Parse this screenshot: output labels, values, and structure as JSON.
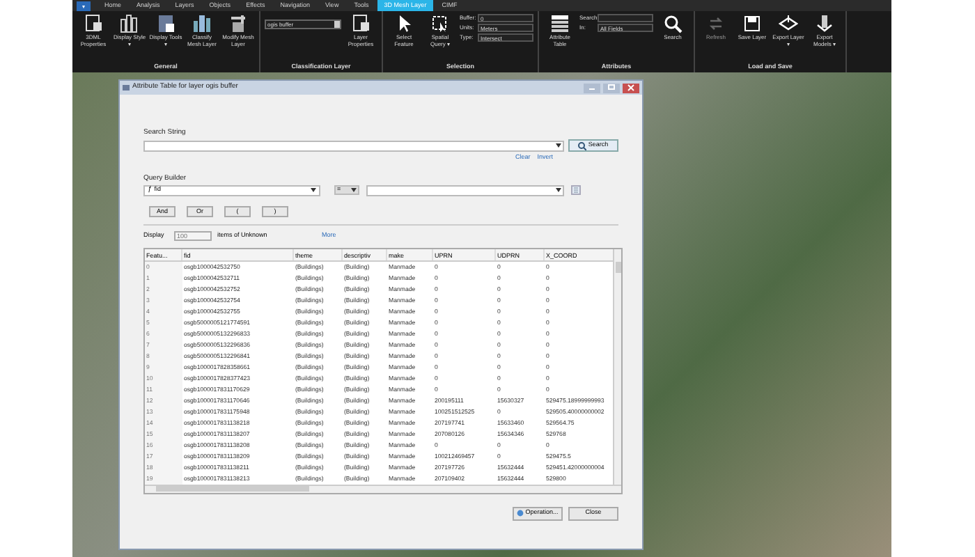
{
  "ribbon": {
    "file_button": "▾",
    "tabs": [
      {
        "label": "Home",
        "selected": false
      },
      {
        "label": "Analysis",
        "selected": false
      },
      {
        "label": "Layers",
        "selected": false
      },
      {
        "label": "Objects",
        "selected": false
      },
      {
        "label": "Effects",
        "selected": false
      },
      {
        "label": "Navigation",
        "selected": false
      },
      {
        "label": "View",
        "selected": false
      },
      {
        "label": "Tools",
        "selected": false
      },
      {
        "label": "3D Mesh Layer",
        "selected": true
      },
      {
        "label": "CIMF",
        "selected": false
      }
    ],
    "groups": [
      {
        "label": "General",
        "items": [
          {
            "kind": "button",
            "label": "3DML Properties"
          },
          {
            "kind": "button",
            "label": "Display Style ▾"
          },
          {
            "kind": "button",
            "label": "Display Tools ▾"
          },
          {
            "kind": "button",
            "label": "Classify Mesh Layer"
          },
          {
            "kind": "button",
            "label": "Modify Mesh Layer"
          }
        ]
      },
      {
        "label": "Classification Layer",
        "items": [
          {
            "kind": "combo",
            "value": "ogis buffer"
          },
          {
            "kind": "button",
            "label": "Layer Properties"
          }
        ]
      },
      {
        "label": "Selection",
        "items": [
          {
            "kind": "button",
            "label": "Select Feature"
          },
          {
            "kind": "button",
            "label": "Spatial Query ▾"
          },
          {
            "kind": "fields",
            "fields": [
              {
                "label": "Buffer:",
                "value": "0"
              },
              {
                "label": "Units:",
                "value": "Meters"
              },
              {
                "label": "Type:",
                "value": "Intersect"
              }
            ]
          }
        ]
      },
      {
        "label": "Attributes",
        "items": [
          {
            "kind": "button",
            "label": "Attribute Table"
          },
          {
            "kind": "fields",
            "fields": [
              {
                "label": "Search:"
              },
              {
                "label": "In:",
                "value": "All Fields"
              }
            ]
          },
          {
            "kind": "button",
            "label": "Search"
          }
        ]
      },
      {
        "label": "Load and Save",
        "items": [
          {
            "kind": "button",
            "label": "Refresh",
            "disabled": true
          },
          {
            "kind": "button",
            "label": "Save Layer",
            "disabled": false
          },
          {
            "kind": "button",
            "label": "Export Layer ▾",
            "disabled": false
          },
          {
            "kind": "button",
            "label": "Export Models ▾",
            "disabled": false
          }
        ]
      }
    ]
  },
  "dialog": {
    "title": "Attribute Table for layer ogis buffer",
    "search_string": {
      "label": "Search String",
      "button": "Search",
      "links": [
        "Clear",
        "Invert"
      ]
    },
    "query_builder": {
      "label": "Query Builder",
      "function_glyph": "ƒ",
      "field": "fid",
      "operator": "=",
      "buttons": [
        "And",
        "Or",
        "(",
        ")"
      ]
    },
    "display": {
      "label": "Display",
      "value": "100",
      "suffix": "items of Unknown",
      "more": "More"
    },
    "table": {
      "columns": [
        "Featu...",
        "fid",
        "theme",
        "descriptiv",
        "make",
        "UPRN",
        "UDPRN",
        "X_COORD"
      ],
      "rows": [
        [
          "0",
          "osgb1000042532750",
          "(Buildings)",
          "(Building)",
          "Manmade",
          "0",
          "0",
          "0"
        ],
        [
          "1",
          "osgb1000042532711",
          "(Buildings)",
          "(Building)",
          "Manmade",
          "0",
          "0",
          "0"
        ],
        [
          "2",
          "osgb1000042532752",
          "(Buildings)",
          "(Building)",
          "Manmade",
          "0",
          "0",
          "0"
        ],
        [
          "3",
          "osgb1000042532754",
          "(Buildings)",
          "(Building)",
          "Manmade",
          "0",
          "0",
          "0"
        ],
        [
          "4",
          "osgb1000042532755",
          "(Buildings)",
          "(Building)",
          "Manmade",
          "0",
          "0",
          "0"
        ],
        [
          "5",
          "osgb5000005121774591",
          "(Buildings)",
          "(Building)",
          "Manmade",
          "0",
          "0",
          "0"
        ],
        [
          "6",
          "osgb5000005132296833",
          "(Buildings)",
          "(Building)",
          "Manmade",
          "0",
          "0",
          "0"
        ],
        [
          "7",
          "osgb5000005132296836",
          "(Buildings)",
          "(Building)",
          "Manmade",
          "0",
          "0",
          "0"
        ],
        [
          "8",
          "osgb5000005132296841",
          "(Buildings)",
          "(Building)",
          "Manmade",
          "0",
          "0",
          "0"
        ],
        [
          "9",
          "osgb1000017828358661",
          "(Buildings)",
          "(Building)",
          "Manmade",
          "0",
          "0",
          "0"
        ],
        [
          "10",
          "osgb1000017828377423",
          "(Buildings)",
          "(Building)",
          "Manmade",
          "0",
          "0",
          "0"
        ],
        [
          "11",
          "osgb1000017831170629",
          "(Buildings)",
          "(Building)",
          "Manmade",
          "0",
          "0",
          "0"
        ],
        [
          "12",
          "osgb1000017831170646",
          "(Buildings)",
          "(Building)",
          "Manmade",
          "200195111",
          "15630327",
          "529475.18999999993"
        ],
        [
          "13",
          "osgb1000017831175948",
          "(Buildings)",
          "(Building)",
          "Manmade",
          "100251512525",
          "0",
          "529505.40000000002"
        ],
        [
          "14",
          "osgb1000017831138218",
          "(Buildings)",
          "(Building)",
          "Manmade",
          "207197741",
          "15633460",
          "529564.75"
        ],
        [
          "15",
          "osgb1000017831138207",
          "(Buildings)",
          "(Building)",
          "Manmade",
          "207080126",
          "15634346",
          "529768"
        ],
        [
          "16",
          "osgb1000017831138208",
          "(Buildings)",
          "(Building)",
          "Manmade",
          "0",
          "0",
          "0"
        ],
        [
          "17",
          "osgb1000017831138209",
          "(Buildings)",
          "(Building)",
          "Manmade",
          "100212469457",
          "0",
          "529475.5"
        ],
        [
          "18",
          "osgb1000017831138211",
          "(Buildings)",
          "(Building)",
          "Manmade",
          "207197726",
          "15632444",
          "529451.42000000004"
        ],
        [
          "19",
          "osgb1000017831138213",
          "(Buildings)",
          "(Building)",
          "Manmade",
          "207109402",
          "15632444",
          "529800"
        ]
      ]
    },
    "footer_buttons": [
      "Operation...",
      "Close"
    ]
  }
}
